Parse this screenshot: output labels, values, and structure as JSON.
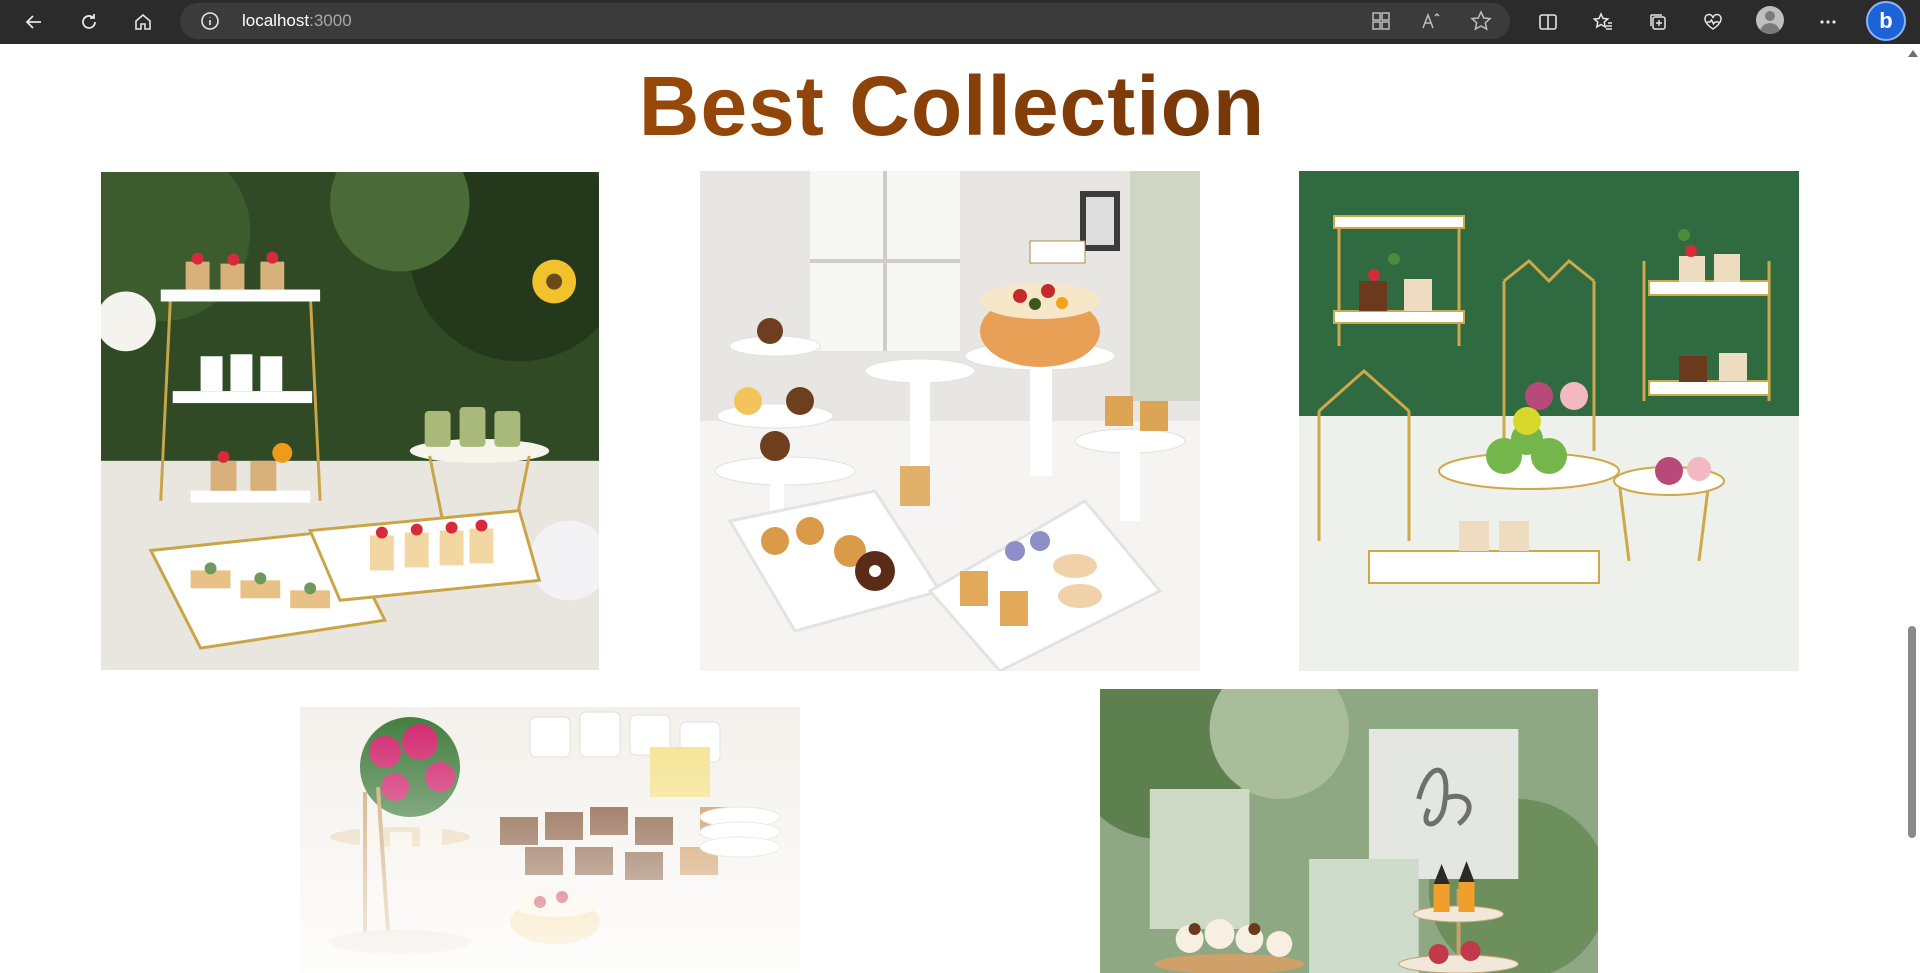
{
  "browser": {
    "url_host": "localhost",
    "url_port": ":3000",
    "toolbar_icons": [
      "back-icon",
      "refresh-icon",
      "home-icon",
      "site-info-icon",
      "apps-icon",
      "read-aloud-icon",
      "favorite-star-icon",
      "split-screen-icon",
      "favorites-icon",
      "collections-icon",
      "browser-essentials-icon",
      "profile-avatar",
      "more-options-icon",
      "copilot-icon"
    ],
    "copilot_glyph": "b"
  },
  "section": {
    "title": "Best Collection"
  },
  "gallery": {
    "images": [
      {
        "subject": "gold tiered dessert stands with cupcakes and sunflowers on outdoor table"
      },
      {
        "subject": "white lace cake stands with cakes, donuts and pastries"
      },
      {
        "subject": "gold and white geometric stands with cupcakes and green apples on green backdrop"
      },
      {
        "subject": "crystal dessert stand with cake and brownies on buffet table"
      },
      {
        "subject": "tiered cupcake stand in a garden with blurred sign"
      }
    ]
  },
  "colors": {
    "title_gradient_start": "#b35a09",
    "title_gradient_end": "#4e2306",
    "chrome_bg": "#2b2b2b",
    "address_bar_bg": "#3b3b3b"
  }
}
